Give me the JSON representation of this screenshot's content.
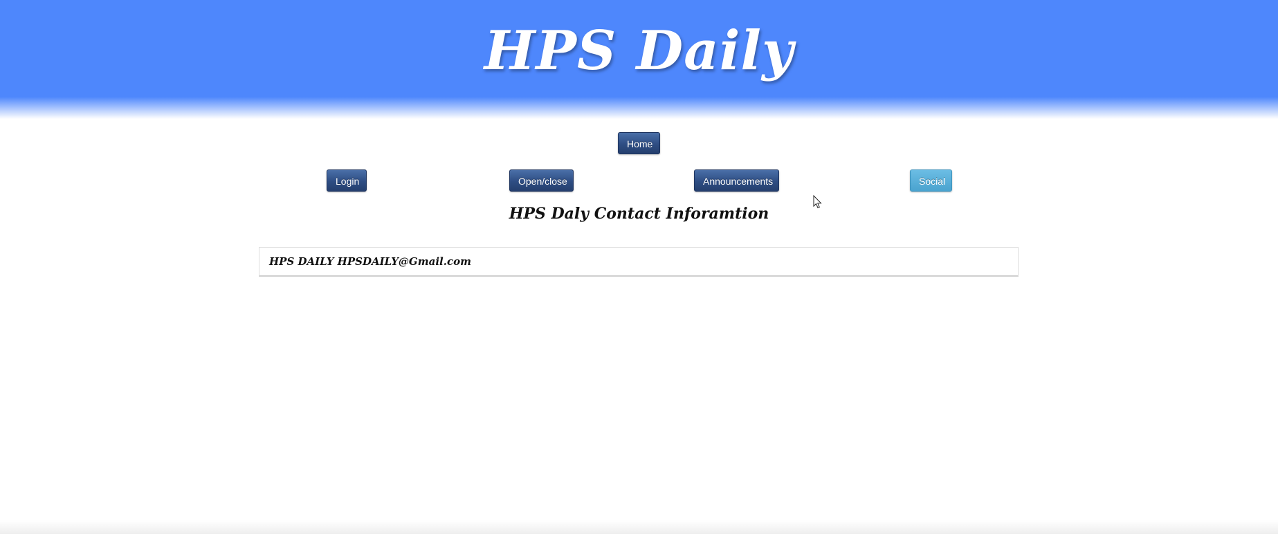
{
  "header": {
    "title": "HPS Daily",
    "background_color": "#4e87fc"
  },
  "nav": {
    "home": "Home",
    "login": "Login",
    "open_close": "Open/close",
    "announcements": "Announcements",
    "social": "Social",
    "active_item": "Social"
  },
  "main": {
    "section_title": "HPS Daly Contact Inforamtion",
    "contact_text": "HPS DAILY HPSDAILY@Gmail.com"
  },
  "icons": {
    "cursor": "mouse-pointer-icon"
  }
}
